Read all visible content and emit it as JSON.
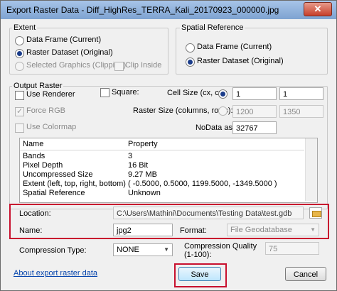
{
  "window": {
    "title": "Export Raster Data - Diff_HighRes_TERRA_Kali_20170923_000000.jpg",
    "close_glyph": "✕"
  },
  "extent": {
    "label": "Extent",
    "options": [
      "Data Frame (Current)",
      "Raster Dataset (Original)",
      "Selected Graphics (Clipping)"
    ],
    "clip_inside": "Clip Inside"
  },
  "spatial_reference": {
    "label": "Spatial Reference",
    "options": [
      "Data Frame (Current)",
      "Raster Dataset (Original)"
    ]
  },
  "output_raster": {
    "label": "Output Raster",
    "use_renderer": "Use Renderer",
    "force_rgb": "Force RGB",
    "use_colormap": "Use Colormap",
    "square": "Square:",
    "cell_size_label": "Cell Size (cx, cy):",
    "cell_size_x": "1",
    "cell_size_y": "1",
    "raster_size_label": "Raster Size (columns, rows):",
    "raster_cols": "1200",
    "raster_rows": "1350",
    "nodata_label": "NoData as:",
    "nodata_value": "32767"
  },
  "properties": {
    "headers": [
      "Name",
      "Property"
    ],
    "rows": [
      [
        "Bands",
        "3"
      ],
      [
        "Pixel Depth",
        "16 Bit"
      ],
      [
        "Uncompressed Size",
        "9.27 MB"
      ],
      [
        "Extent (left, top, right, bottom)",
        "( -0.5000, 0.5000, 1199.5000, -1349.5000 )"
      ],
      [
        "Spatial Reference",
        "Unknown"
      ]
    ]
  },
  "location": {
    "label": "Location:",
    "value": "C:\\Users\\Mathini\\Documents\\Testing Data\\test.gdb"
  },
  "name": {
    "label": "Name:",
    "value": "jpg2"
  },
  "format": {
    "label": "Format:",
    "value": "File Geodatabase"
  },
  "compression": {
    "type_label": "Compression Type:",
    "type_value": "NONE",
    "quality_label": "Compression Quality",
    "quality_label_2": "(1-100):",
    "quality_value": "75"
  },
  "footer": {
    "about_link": "About export raster data",
    "save": "Save",
    "cancel": "Cancel"
  }
}
